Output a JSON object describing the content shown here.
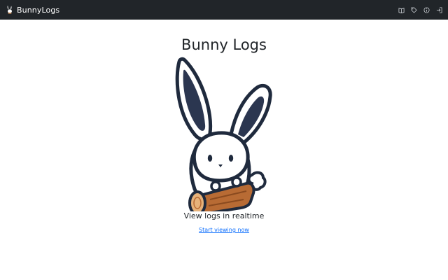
{
  "navbar": {
    "brand_name": "BunnyLogs",
    "icons": [
      "book-icon",
      "tag-icon",
      "info-icon",
      "login-icon"
    ]
  },
  "main": {
    "title": "Bunny Logs",
    "tagline": "View logs in realtime",
    "cta_label": "Start viewing now"
  },
  "colors": {
    "navbar_bg": "#212529",
    "link": "#0d6efd",
    "text": "#212529",
    "rabbit_outline": "#1f2a3d",
    "log_wood": "#b86b34"
  }
}
